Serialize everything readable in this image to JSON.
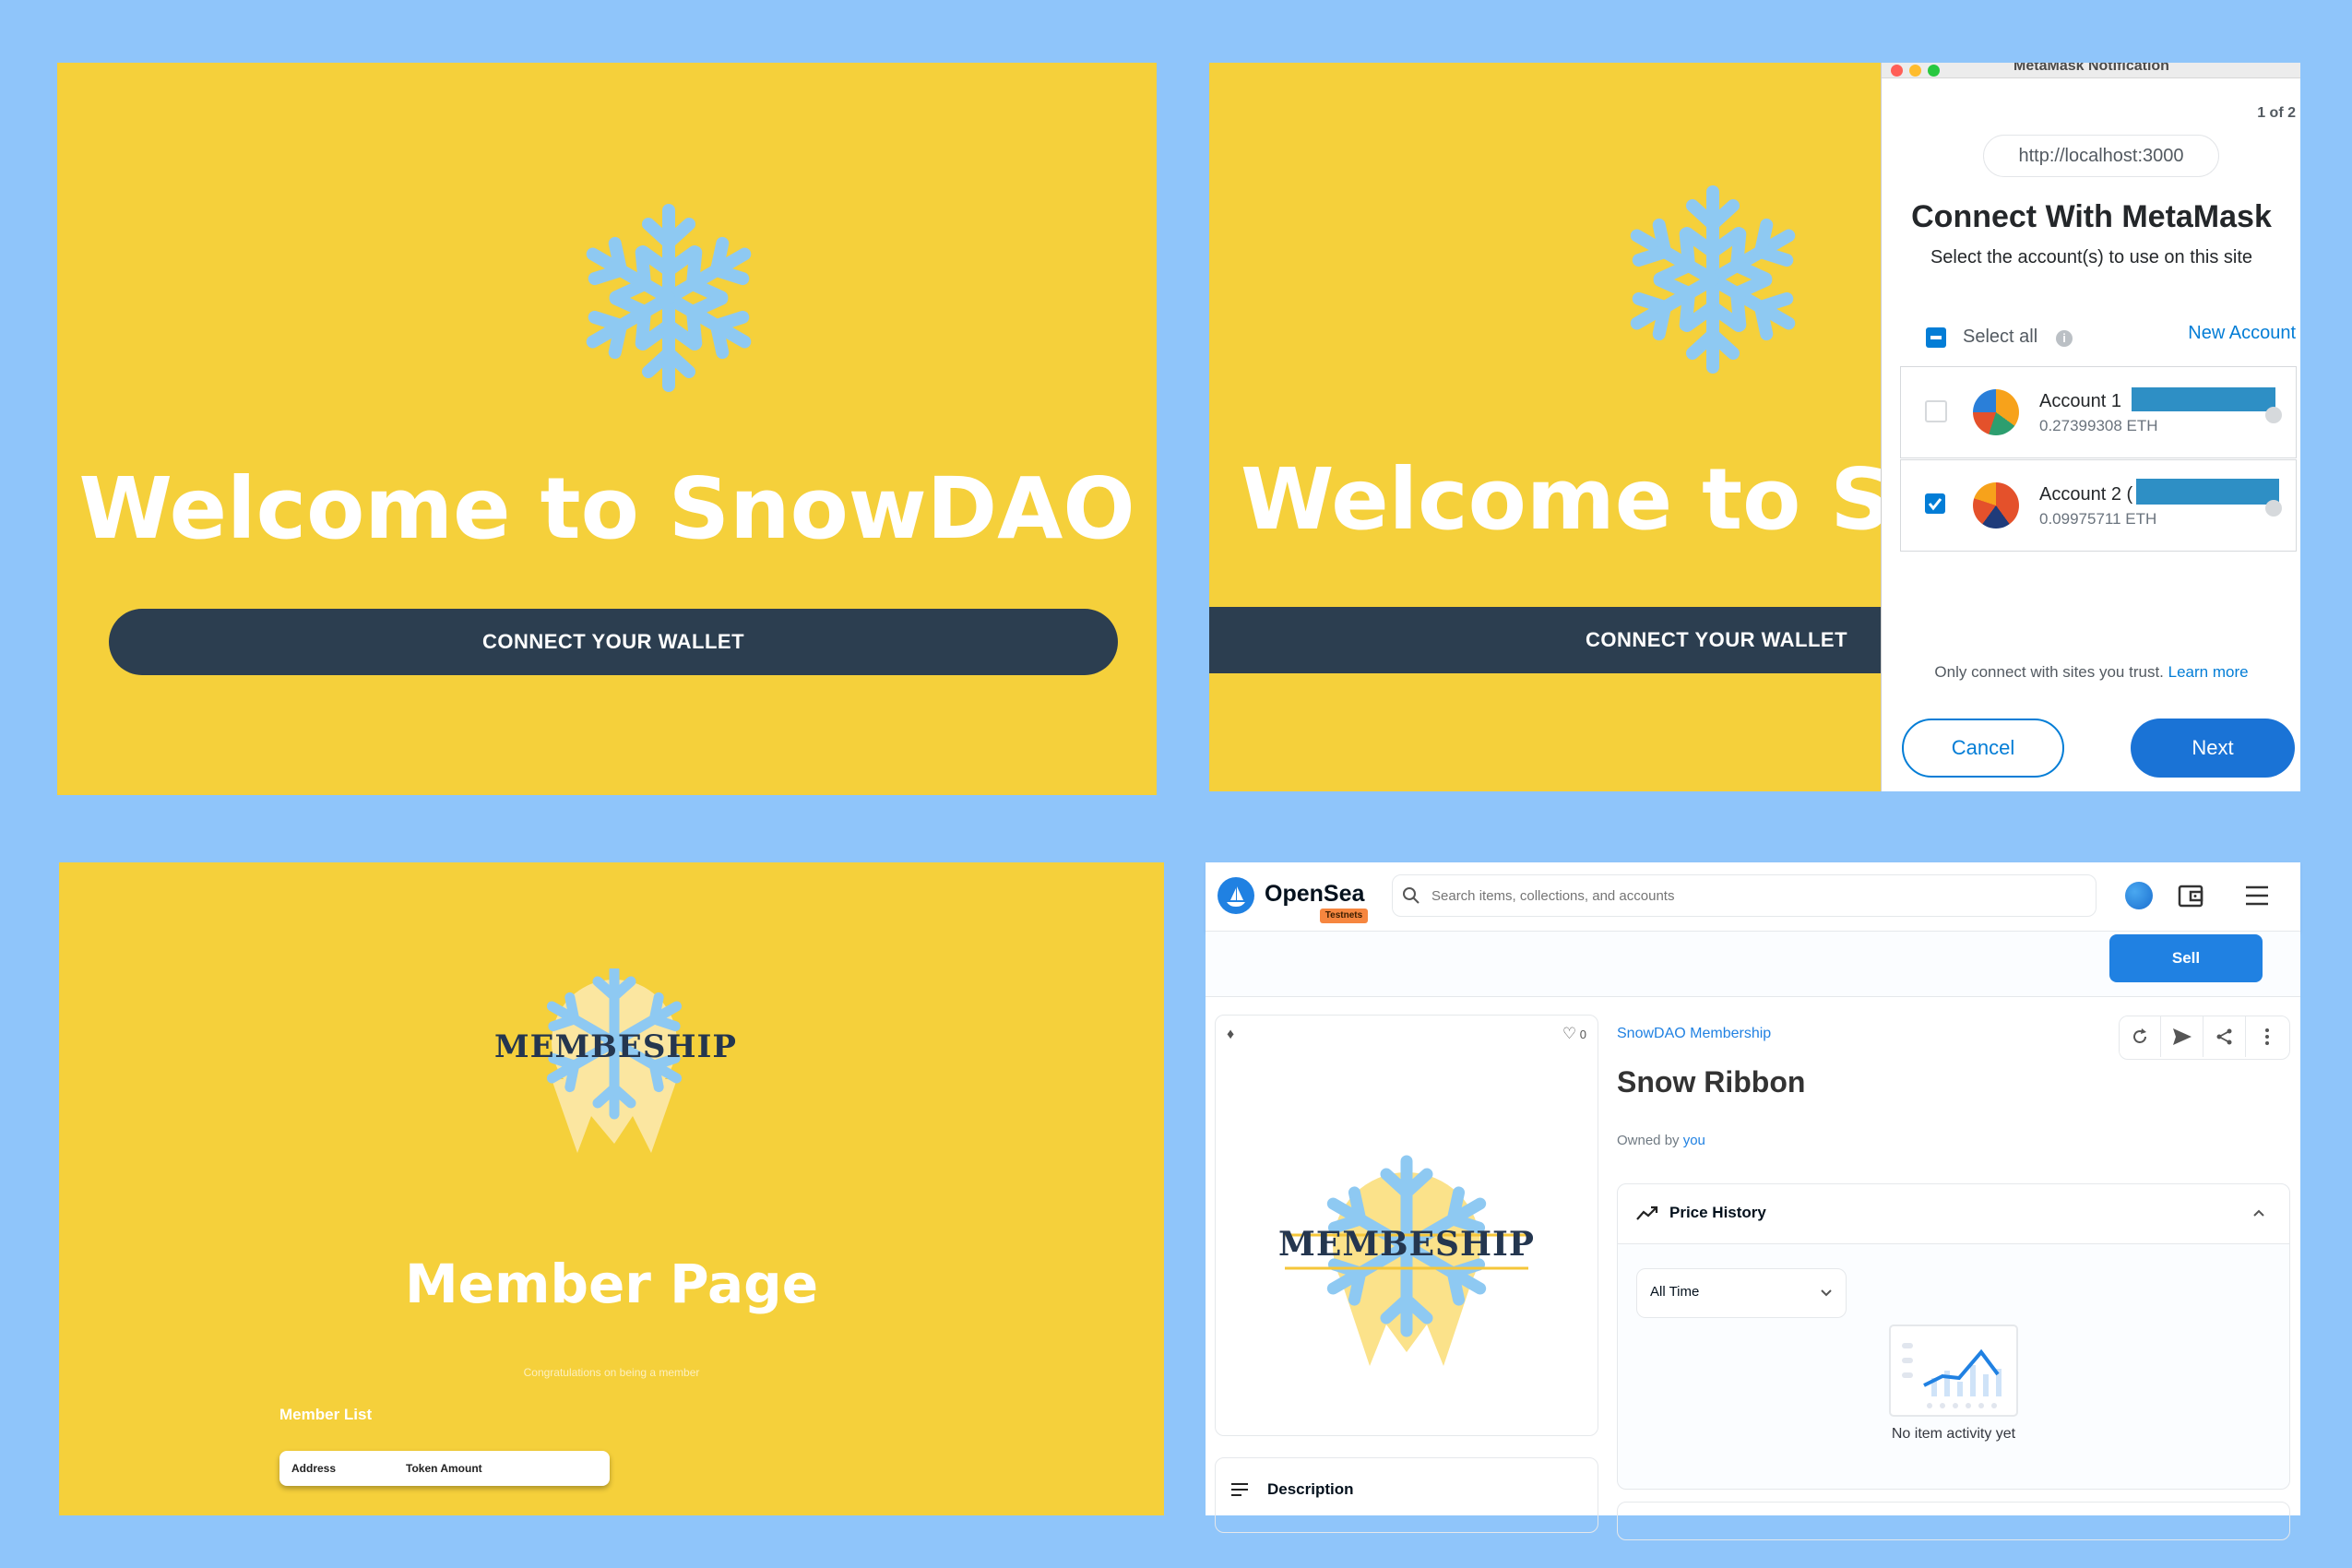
{
  "panel1": {
    "title": "Welcome to SnowDAO",
    "button": "CONNECT YOUR WALLET"
  },
  "panel2": {
    "title": "Welcome to Sn",
    "button": "CONNECT YOUR WALLET"
  },
  "metamask": {
    "window_title": "MetaMask Notification",
    "pager": "1 of 2",
    "origin": "http://localhost:3000",
    "heading": "Connect With MetaMask",
    "subheading": "Select the account(s) to use on this site",
    "select_all": "Select all",
    "new_account": "New Account",
    "accounts": [
      {
        "name": "Account 1",
        "balance": "0.27399308 ETH",
        "checked": false
      },
      {
        "name": "Account 2 (",
        "balance": "0.09975711 ETH",
        "checked": true
      }
    ],
    "trust_text": "Only connect with sites you trust.",
    "learn_more": "Learn more",
    "cancel": "Cancel",
    "next": "Next",
    "accent": "#037dd6"
  },
  "panel3": {
    "logo_text": "MEMBESHIP",
    "title": "Member Page",
    "congrats": "Congratulations on being a member",
    "list_label": "Member List",
    "columns": [
      "Address",
      "Token Amount"
    ]
  },
  "opensea": {
    "brand": "OpenSea",
    "badge": "Testnets",
    "search_placeholder": "Search items, collections, and accounts",
    "sell": "Sell",
    "favorites": "0",
    "collection": "SnowDAO Membership",
    "item_name": "Snow Ribbon",
    "owned_by": "Owned by",
    "owner": "you",
    "price_history": "Price History",
    "time_filter": "All Time",
    "no_activity": "No item activity yet",
    "description": "Description",
    "logo_text": "MEMBESHIP"
  }
}
